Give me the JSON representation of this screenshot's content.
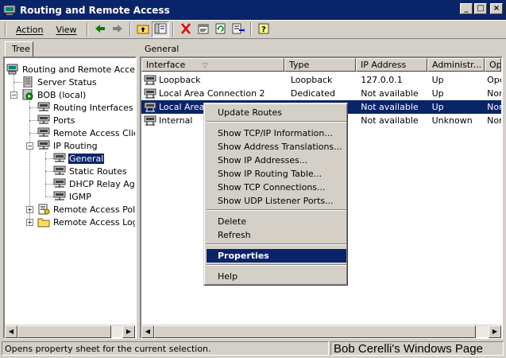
{
  "window": {
    "title": "Routing and Remote Access",
    "buttons": [
      "_",
      "□",
      "×"
    ]
  },
  "menu": {
    "action": "Action",
    "view": "View"
  },
  "toolbar": {
    "icons": [
      "back-arrow-icon",
      "forward-arrow-icon",
      "up-folder-icon",
      "show-hide-tree-icon",
      "delete-icon",
      "properties-icon",
      "refresh-icon",
      "export-list-icon",
      "help-icon"
    ]
  },
  "left_pane": {
    "tab_label": "Tree",
    "tree": [
      {
        "label": "Routing and Remote Access"
      },
      {
        "label": "Server Status"
      },
      {
        "label": "BOB (local)"
      },
      {
        "label": "Routing Interfaces"
      },
      {
        "label": "Ports"
      },
      {
        "label": "Remote Access Clients"
      },
      {
        "label": "IP Routing"
      },
      {
        "label": "General"
      },
      {
        "label": "Static Routes"
      },
      {
        "label": "DHCP Relay Agent"
      },
      {
        "label": "IGMP"
      },
      {
        "label": "Remote Access Policies"
      },
      {
        "label": "Remote Access Logging"
      }
    ]
  },
  "right_pane": {
    "title": "General",
    "columns": [
      "Interface",
      "Type",
      "IP Address",
      "Administr...",
      "Ope"
    ],
    "rows": [
      {
        "interface": "Loopback",
        "type": "Loopback",
        "ip": "127.0.0.1",
        "admin": "Up",
        "oper": "Ope"
      },
      {
        "interface": "Local Area Connection 2",
        "type": "Dedicated",
        "ip": "Not available",
        "admin": "Up",
        "oper": "Nor"
      },
      {
        "interface": "Local Area C",
        "type": "",
        "ip": "Not available",
        "admin": "Up",
        "oper": "Nor"
      },
      {
        "interface": "Internal",
        "type": "",
        "ip": "Not available",
        "admin": "Unknown",
        "oper": "Nor"
      }
    ]
  },
  "context_menu": {
    "items": [
      "Update Routes",
      "Show TCP/IP Information...",
      "Show Address Translations...",
      "Show IP Addresses...",
      "Show IP Routing Table...",
      "Show TCP Connections...",
      "Show UDP Listener Ports...",
      "Delete",
      "Refresh",
      "Properties",
      "Help"
    ]
  },
  "status_bar": {
    "text": "Opens property sheet for the current selection.",
    "right_text": "Bob Cerelli's Windows Page"
  },
  "colors": {
    "title_bar": "#0a246a",
    "selection": "#0a246a",
    "face": "#d4d0c8"
  }
}
